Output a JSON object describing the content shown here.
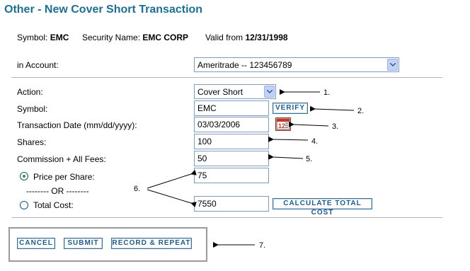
{
  "page": {
    "title": "Other - New Cover Short Transaction"
  },
  "info": {
    "symbol_label": "Symbol:",
    "symbol_value": "EMC",
    "security_label": "Security Name:",
    "security_value": "EMC CORP",
    "valid_label": "Valid from",
    "valid_value": "12/31/1998"
  },
  "account": {
    "label": "in Account:",
    "value": "Ameritrade -- 123456789"
  },
  "form": {
    "action": {
      "label": "Action:",
      "value": "Cover Short"
    },
    "symbol": {
      "label": "Symbol:",
      "value": "EMC",
      "verify_label": "VERIFY"
    },
    "date": {
      "label": "Transaction Date (mm/dd/yyyy):",
      "value": "03/03/2006"
    },
    "shares": {
      "label": "Shares:",
      "value": "100"
    },
    "commission": {
      "label": "Commission + All Fees:",
      "value": "50"
    },
    "price": {
      "label": "Price per Share:",
      "value": "75",
      "selected": true
    },
    "or_text": "-------- OR --------",
    "total": {
      "label": "Total Cost:",
      "value": "7550",
      "selected": false,
      "calculate_label": "CALCULATE TOTAL COST"
    }
  },
  "buttons": {
    "cancel": "CANCEL",
    "submit": "SUBMIT",
    "record_repeat": "RECORD & REPEAT"
  },
  "callouts": {
    "c1": "1.",
    "c2": "2.",
    "c3": "3.",
    "c4": "4.",
    "c5": "5.",
    "c6": "6.",
    "c7": "7."
  },
  "colors": {
    "title": "#1f6e8f",
    "button_text": "#1f5b86",
    "radio_selected": "#21a121"
  },
  "icons": {
    "calendar": "calendar-icon",
    "dropdown": "chevron-down-icon"
  }
}
